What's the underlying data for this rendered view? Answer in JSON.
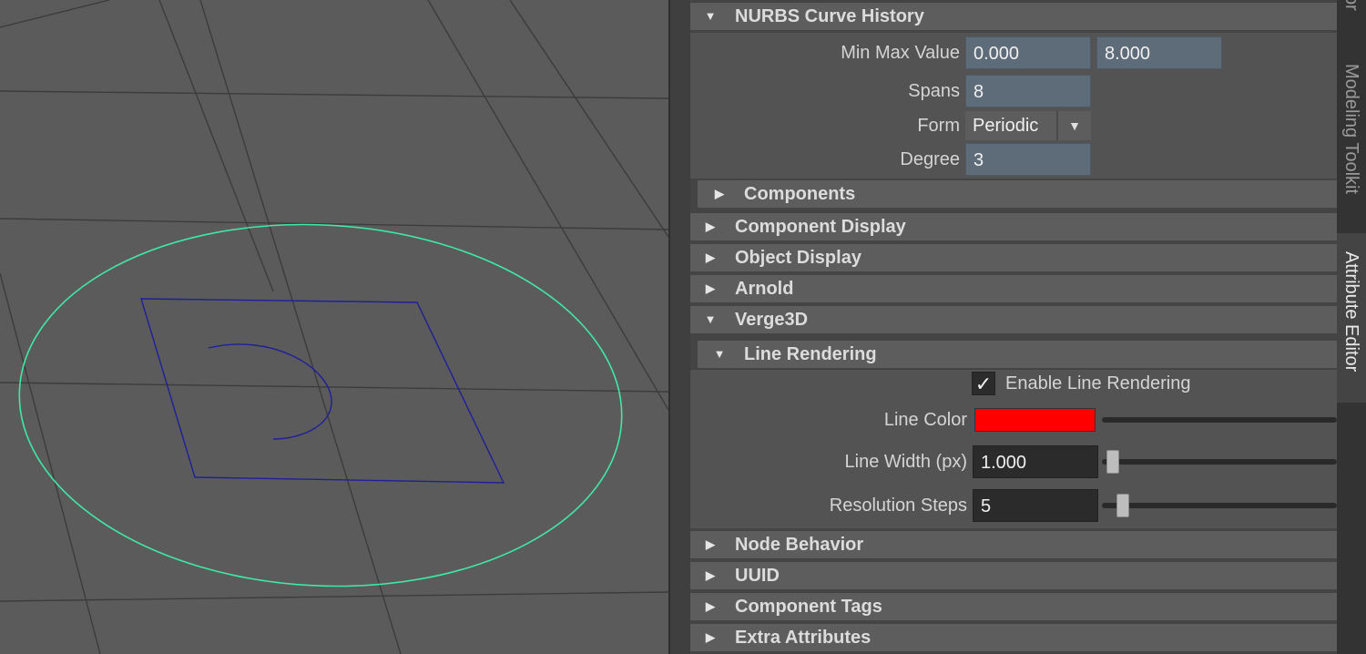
{
  "viewport": {
    "curve_colors": {
      "circle": "#3fe8a8",
      "square": "#1f1f9a",
      "arc": "#1f1f9a",
      "grid": "#3a3a3a"
    }
  },
  "attribute_editor": {
    "nurbs_history": {
      "header": "NURBS Curve History",
      "min_max_label": "Min Max Value",
      "min_value": "0.000",
      "max_value": "8.000",
      "spans_label": "Spans",
      "spans_value": "8",
      "form_label": "Form",
      "form_value": "Periodic",
      "degree_label": "Degree",
      "degree_value": "3"
    },
    "components_header": "Components",
    "component_display_header": "Component Display",
    "object_display_header": "Object Display",
    "arnold_header": "Arnold",
    "verge3d": {
      "header": "Verge3D",
      "line_rendering": {
        "header": "Line Rendering",
        "enable_label": "Enable Line Rendering",
        "enabled": true,
        "line_color_label": "Line Color",
        "line_color": "#ff0000",
        "line_width_label": "Line Width (px)",
        "line_width_value": "1.000",
        "resolution_label": "Resolution Steps",
        "resolution_value": "5"
      }
    },
    "node_behavior_header": "Node Behavior",
    "uuid_header": "UUID",
    "component_tags_header": "Component Tags",
    "extra_attributes_header": "Extra Attributes"
  },
  "side_tabs": {
    "top_tab_fragment": "or",
    "modeling_toolkit": "Modeling Toolkit",
    "attribute_editor": "Attribute Editor"
  },
  "icons": {
    "expanded": "triangle-down-icon",
    "collapsed": "triangle-right-icon",
    "dropdown": "dropdown-arrow-icon",
    "check": "checkmark-icon"
  }
}
